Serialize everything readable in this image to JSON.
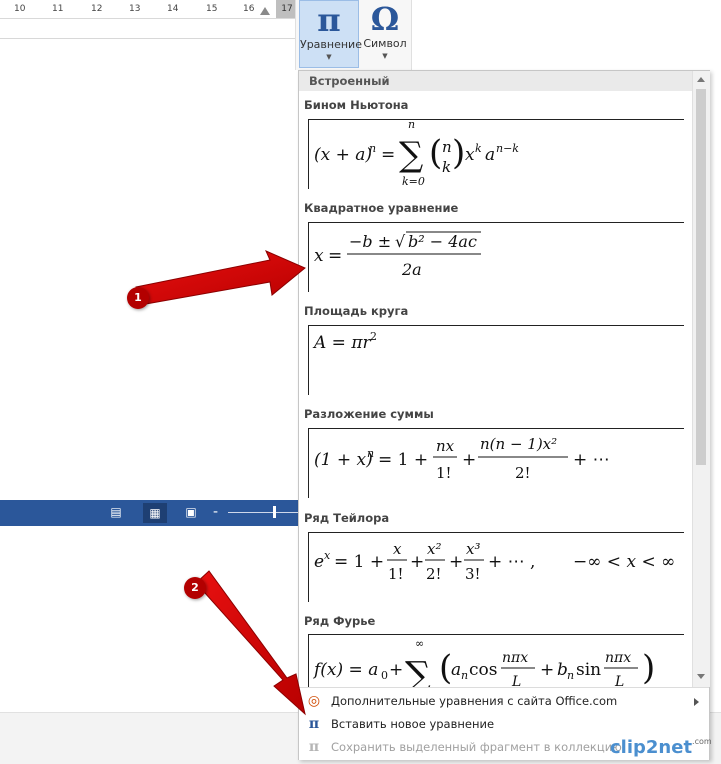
{
  "ruler": {
    "ticks": [
      "10",
      "11",
      "12",
      "13",
      "14",
      "15",
      "16",
      "17"
    ],
    "right_number": "17"
  },
  "ribbon": {
    "equation": {
      "glyph": "π",
      "label": "Уравнение"
    },
    "symbol": {
      "glyph": "Ω",
      "label": "Символ"
    }
  },
  "gallery": {
    "header": "Встроенный",
    "items": [
      {
        "title": "Бином Ньютона"
      },
      {
        "title": "Квадратное уравнение"
      },
      {
        "title": "Площадь круга"
      },
      {
        "title": "Разложение суммы"
      },
      {
        "title": "Ряд Тейлора"
      },
      {
        "title": "Ряд Фурье"
      }
    ],
    "footer": [
      {
        "label": "Дополнительные уравнения с сайта Office.com",
        "icon": "office-icon",
        "disabled": false
      },
      {
        "label": "Вставить новое уравнение",
        "icon": "pi-icon",
        "disabled": false
      },
      {
        "label": "Сохранить выделенный фрагмент в коллекцию",
        "icon": "save-gallery-icon",
        "disabled": true
      }
    ]
  },
  "annotations": {
    "badge1": "1",
    "badge2": "2"
  },
  "watermark": {
    "text": "clip2net",
    "suffix": ".com"
  },
  "colors": {
    "accent": "#2b579a",
    "arrow": "#d40000",
    "statusbar": "#2b579a"
  }
}
